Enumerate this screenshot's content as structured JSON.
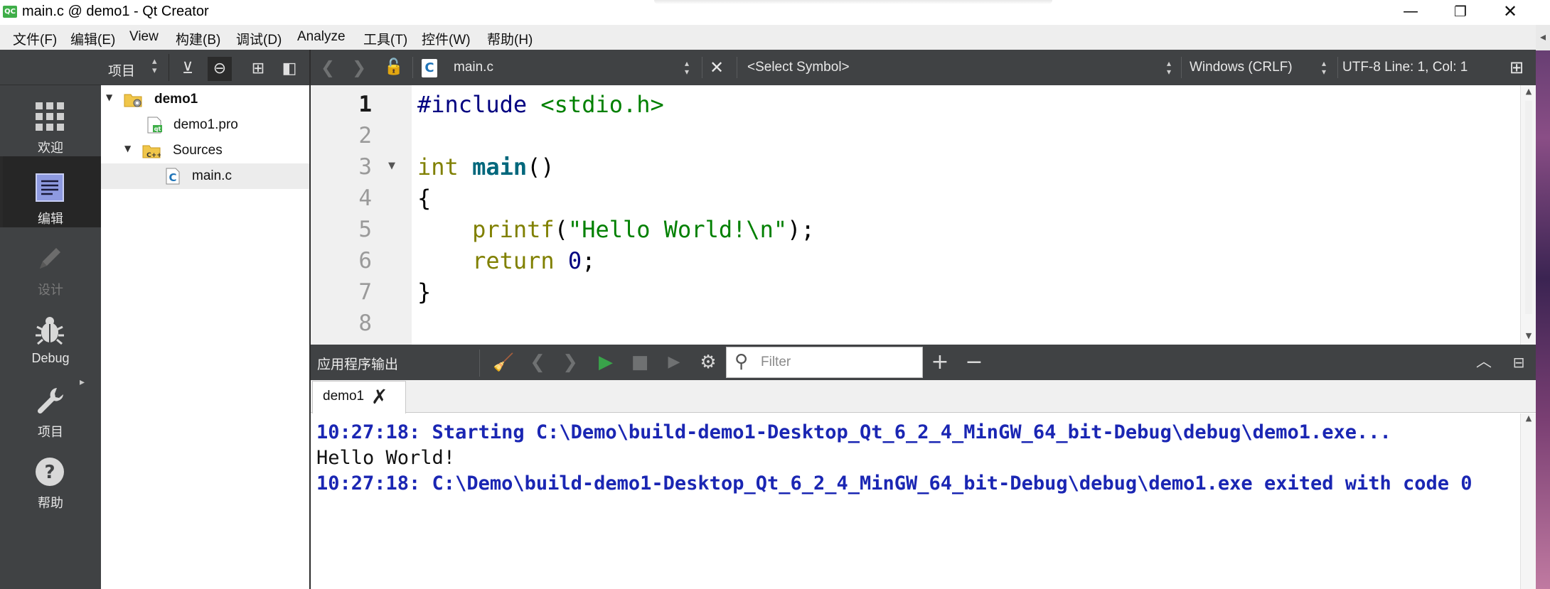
{
  "window": {
    "logo_text": "QC",
    "title": "main.c @ demo1 - Qt Creator",
    "min_glyph": "—",
    "max_glyph": "❐",
    "close_glyph": "✕"
  },
  "menubar": {
    "items": [
      "文件(F)",
      "编辑(E)",
      "View",
      "构建(B)",
      "调试(D)",
      "Analyze",
      "工具(T)",
      "控件(W)",
      "帮助(H)"
    ]
  },
  "modes": {
    "welcome": "欢迎",
    "edit": "编辑",
    "design": "设计",
    "debug": "Debug",
    "projects": "项目",
    "help": "帮助"
  },
  "project_pane": {
    "selector": "项目",
    "tree": [
      {
        "label": "demo1",
        "kind": "project"
      },
      {
        "label": "demo1.pro",
        "kind": "pro-file"
      },
      {
        "label": "Sources",
        "kind": "folder"
      },
      {
        "label": "main.c",
        "kind": "c-file",
        "selected": true
      }
    ]
  },
  "editor_toolbar": {
    "file_name": "main.c",
    "symbol": "<Select Symbol>",
    "line_endings": "Windows (CRLF)",
    "status": "UTF-8  Line: 1, Col: 1"
  },
  "editor": {
    "line_numbers": [
      "1",
      "2",
      "3",
      "4",
      "5",
      "6",
      "7",
      "8"
    ],
    "current_line": 1,
    "code": {
      "l1_directive": "#include",
      "l1_header": " <stdio.h>",
      "l3_type": "int",
      "l3_name": "main",
      "l3_parens": "()",
      "l4": "{",
      "l5_call": "printf",
      "l5_open": "(",
      "l5_string": "\"Hello World!\\n\"",
      "l5_close": ");",
      "l6_keyword": "return",
      "l6_value": "0",
      "l6_end": ";",
      "l7": "}"
    }
  },
  "output_pane": {
    "title": "应用程序输出",
    "filter_placeholder": "Filter",
    "tab_label": "demo1",
    "lines": [
      {
        "text": "10:27:18: Starting C:\\Demo\\build-demo1-Desktop_Qt_6_2_4_MinGW_64_bit-Debug\\debug\\demo1.exe...",
        "kind": "system"
      },
      {
        "text": "Hello World!",
        "kind": "stdout"
      },
      {
        "text": "10:27:18: C:\\Demo\\build-demo1-Desktop_Qt_6_2_4_MinGW_64_bit-Debug\\debug\\demo1.exe exited with code 0",
        "kind": "system"
      }
    ]
  },
  "colors": {
    "sidebar": "#404244",
    "active_mode": "#262626",
    "output_system_text": "#1a26b3",
    "run_green": "#39a34a"
  }
}
